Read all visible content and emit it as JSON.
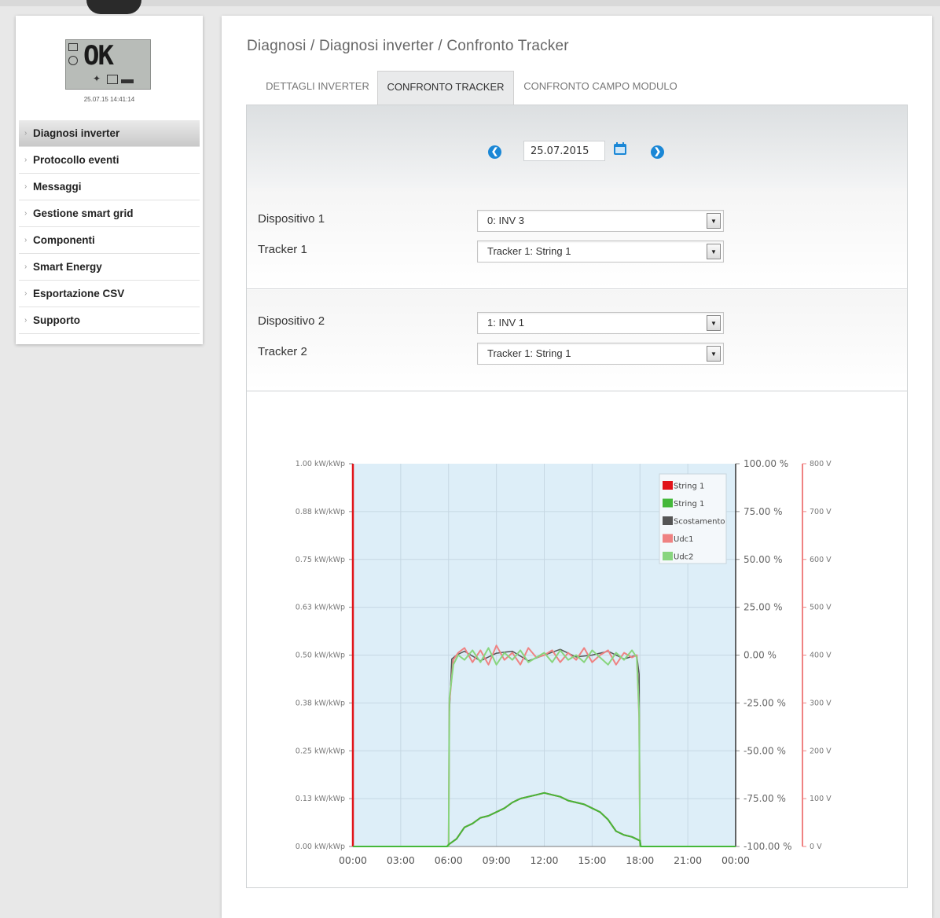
{
  "sidebar": {
    "lcd": {
      "status": "OK",
      "datetime": "25.07.15 14:41:14"
    },
    "menu": [
      {
        "label": "Diagnosi inverter",
        "active": true
      },
      {
        "label": "Protocollo eventi"
      },
      {
        "label": "Messaggi"
      },
      {
        "label": "Gestione smart grid"
      },
      {
        "label": "Componenti"
      },
      {
        "label": "Smart Energy"
      },
      {
        "label": "Esportazione CSV"
      },
      {
        "label": "Supporto"
      }
    ]
  },
  "breadcrumb": "Diagnosi / Diagnosi inverter / Confronto Tracker",
  "tabs": [
    {
      "label": "DETTAGLI INVERTER"
    },
    {
      "label": "CONFRONTO TRACKER",
      "active": true
    },
    {
      "label": "CONFRONTO CAMPO MODULO"
    }
  ],
  "date": "25.07.2015",
  "device1": {
    "label": "Dispositivo 1",
    "value": "0: INV 3"
  },
  "tracker1": {
    "label": "Tracker 1",
    "value": "Tracker 1: String 1"
  },
  "device2": {
    "label": "Dispositivo 2",
    "value": "1: INV 1"
  },
  "tracker2": {
    "label": "Tracker 2",
    "value": "Tracker 1: String 1"
  },
  "colors": {
    "accent": "#1a87d6",
    "plot_bg": "#ddeef8",
    "string1_a": "#e1141a",
    "string1_b": "#45b83a",
    "scostamento": "#555555",
    "udc1": "#ef8282",
    "udc2": "#88d57e"
  },
  "chart_data": {
    "type": "line",
    "x_ticks": [
      "00:00",
      "03:00",
      "06:00",
      "09:00",
      "12:00",
      "15:00",
      "18:00",
      "21:00",
      "00:00"
    ],
    "y_left_ticks": [
      "1.00 kW/kWp",
      "0.88 kW/kWp",
      "0.75 kW/kWp",
      "0.63 kW/kWp",
      "0.50 kW/kWp",
      "0.38 kW/kWp",
      "0.25 kW/kWp",
      "0.13 kW/kWp",
      "0.00 kW/kWp"
    ],
    "y_mid_ticks": [
      "100.00 %",
      "75.00 %",
      "50.00 %",
      "25.00 %",
      "0.00 %",
      "-25.00 %",
      "-50.00 %",
      "-75.00 %",
      "-100.00 %"
    ],
    "y_right_ticks": [
      "800 V",
      "700 V",
      "600 V",
      "500 V",
      "400 V",
      "300 V",
      "200 V",
      "100 V",
      "0 V"
    ],
    "ylim_left": [
      0,
      1
    ],
    "ylim_mid": [
      -100,
      100
    ],
    "ylim_right": [
      0,
      800
    ],
    "xlim_hours": [
      0,
      24
    ],
    "grid": true,
    "legend_position": "top-right",
    "legend": [
      "String 1",
      "String 1",
      "Scostamento",
      "Udc1",
      "Udc2"
    ],
    "series": [
      {
        "name": "String 1",
        "axis": "left",
        "x": [
          0,
          5.9,
          6.0,
          6.5,
          7.0,
          7.5,
          8.0,
          8.5,
          9.0,
          9.5,
          10.0,
          10.5,
          11.0,
          11.5,
          12.0,
          12.5,
          13.0,
          13.5,
          14.0,
          14.5,
          15.0,
          15.5,
          16.0,
          16.5,
          17.0,
          17.5,
          18.0,
          18.05,
          24
        ],
        "y": [
          0,
          0,
          0.005,
          0.02,
          0.05,
          0.06,
          0.075,
          0.08,
          0.09,
          0.1,
          0.115,
          0.125,
          0.13,
          0.135,
          0.14,
          0.135,
          0.13,
          0.12,
          0.115,
          0.11,
          0.1,
          0.09,
          0.07,
          0.04,
          0.03,
          0.025,
          0.015,
          0,
          0
        ]
      },
      {
        "name": "String 1",
        "axis": "left",
        "x": [
          0,
          5.9,
          6.0,
          6.5,
          7.0,
          7.5,
          8.0,
          8.5,
          9.0,
          9.5,
          10.0,
          10.5,
          11.0,
          11.5,
          12.0,
          12.5,
          13.0,
          13.5,
          14.0,
          14.5,
          15.0,
          15.5,
          16.0,
          16.5,
          17.0,
          17.5,
          18.0,
          18.05,
          24
        ],
        "y": [
          0,
          0,
          0.005,
          0.02,
          0.05,
          0.06,
          0.075,
          0.08,
          0.09,
          0.1,
          0.115,
          0.125,
          0.13,
          0.135,
          0.14,
          0.135,
          0.13,
          0.12,
          0.115,
          0.11,
          0.1,
          0.09,
          0.07,
          0.04,
          0.03,
          0.025,
          0.015,
          0,
          0
        ]
      },
      {
        "name": "Scostamento",
        "axis": "mid",
        "x": [
          0,
          6.0,
          6.05,
          6.2,
          6.5,
          7.0,
          8.0,
          9.0,
          10.0,
          11.0,
          12.0,
          13.0,
          14.0,
          15.0,
          16.0,
          17.0,
          17.8,
          17.95,
          18.0,
          24
        ],
        "y": [
          -100,
          -100,
          -30,
          -2,
          0,
          2,
          -3,
          1,
          2,
          -3,
          0,
          3,
          -1,
          0,
          2,
          -2,
          0,
          -10,
          -100,
          -100
        ]
      },
      {
        "name": "Udc1",
        "axis": "right",
        "x": [
          0,
          6.0,
          6.05,
          6.3,
          6.6,
          7.0,
          7.5,
          8.0,
          8.5,
          9.0,
          9.5,
          10.0,
          10.5,
          11.0,
          11.5,
          12.0,
          12.5,
          13.0,
          13.5,
          14.0,
          14.5,
          15.0,
          15.5,
          16.0,
          16.5,
          17.0,
          17.5,
          17.8,
          17.95,
          18.0,
          24
        ],
        "y": [
          0,
          0,
          300,
          390,
          405,
          415,
          385,
          410,
          380,
          420,
          390,
          405,
          380,
          415,
          395,
          400,
          410,
          385,
          405,
          390,
          415,
          385,
          400,
          410,
          380,
          405,
          395,
          400,
          270,
          0,
          0
        ]
      },
      {
        "name": "Udc2",
        "axis": "right",
        "x": [
          0,
          6.0,
          6.05,
          6.3,
          6.6,
          7.0,
          7.5,
          8.0,
          8.5,
          9.0,
          9.5,
          10.0,
          10.5,
          11.0,
          11.5,
          12.0,
          12.5,
          13.0,
          13.5,
          14.0,
          14.5,
          15.0,
          15.5,
          16.0,
          16.5,
          17.0,
          17.5,
          17.8,
          17.95,
          18.0,
          24
        ],
        "y": [
          0,
          0,
          310,
          380,
          400,
          390,
          410,
          385,
          415,
          380,
          405,
          390,
          410,
          385,
          395,
          405,
          385,
          410,
          390,
          400,
          385,
          410,
          395,
          380,
          405,
          390,
          410,
          395,
          280,
          0,
          0
        ]
      }
    ]
  }
}
